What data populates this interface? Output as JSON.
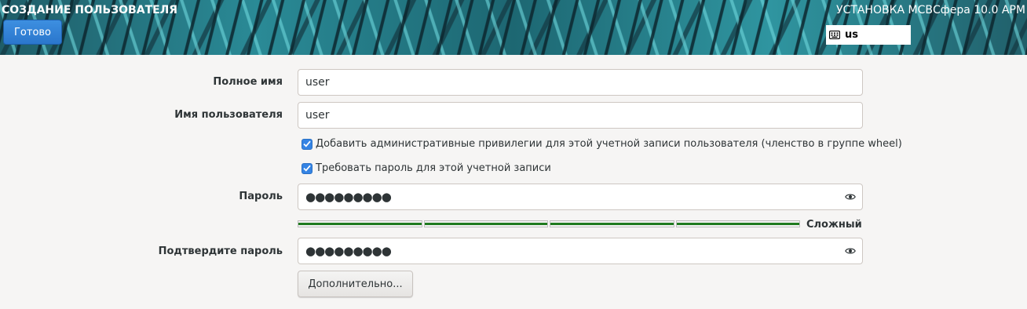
{
  "header": {
    "spoke_title": "СОЗДАНИЕ ПОЛЬЗОВАТЕЛЯ",
    "done_label": "Готово",
    "product_title": "УСТАНОВКА МСВСфера 10.0 АРМ",
    "keyboard_layout": "us"
  },
  "form": {
    "fullname": {
      "label": "Полное имя",
      "value": "user"
    },
    "username": {
      "label": "Имя пользователя",
      "value": "user"
    },
    "admin_checkbox": {
      "label": "Добавить административные привилегии для этой учетной записи пользователя (членство в группе wheel)",
      "checked": true
    },
    "require_password_checkbox": {
      "label": "Требовать пароль для этой учетной записи",
      "checked": true
    },
    "password": {
      "label": "Пароль",
      "value": "●●●●●●●●●"
    },
    "strength": {
      "label": "Сложный",
      "level": 1.0,
      "color": "#1f7a1f"
    },
    "confirm": {
      "label": "Подтвердите пароль",
      "value": "●●●●●●●●●"
    },
    "advanced_label": "Дополнительно..."
  },
  "colors": {
    "accent": "#3584e4",
    "background": "#f6f5f4"
  }
}
